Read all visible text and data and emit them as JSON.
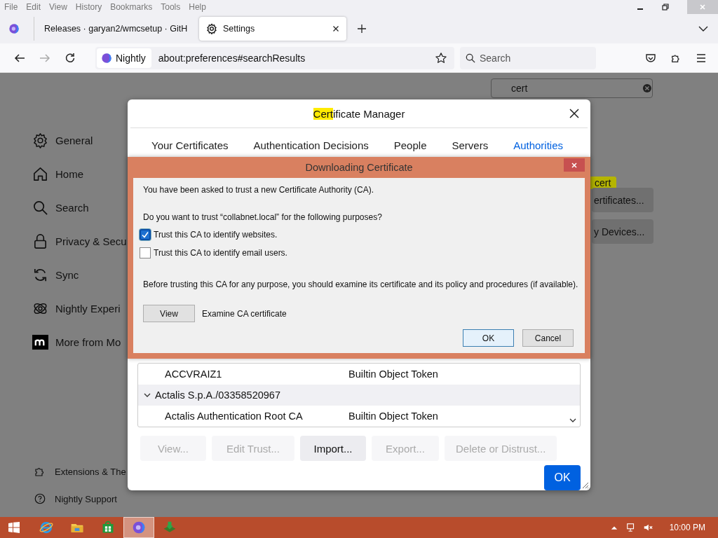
{
  "menu_bar": [
    "File",
    "Edit",
    "View",
    "History",
    "Bookmarks",
    "Tools",
    "Help"
  ],
  "tabs": [
    {
      "kind": "page",
      "title": "Releases · garyan2/wmcsetup · GitH",
      "selected": false
    },
    {
      "kind": "settings",
      "title": "Settings",
      "selected": true
    }
  ],
  "nav": {
    "identity": "Nightly",
    "url": "about:preferences#searchResults",
    "search_placeholder": "Search"
  },
  "preferences": {
    "search": {
      "value": "cert"
    },
    "sidebar": [
      {
        "kind": "gear",
        "label": "General"
      },
      {
        "kind": "home",
        "label": "Home"
      },
      {
        "kind": "search",
        "label": "Search"
      },
      {
        "kind": "lock",
        "label": "Privacy & Secu"
      },
      {
        "kind": "sync",
        "label": "Sync"
      },
      {
        "kind": "atom",
        "label": "Nightly Experi"
      },
      {
        "kind": "mozilla",
        "label": "More from Mo"
      }
    ],
    "footer": [
      {
        "kind": "puzzle",
        "label": "Extensions & The"
      },
      {
        "kind": "help",
        "label": "Nightly Support"
      }
    ],
    "highlight_tag": "cert",
    "buttons": [
      "ertificates...",
      "y Devices..."
    ]
  },
  "certificate_manager": {
    "title_parts": [
      {
        "text": "Cert",
        "highlighted": true
      },
      {
        "text": "ificate Manager",
        "highlighted": false
      }
    ],
    "tabs": [
      {
        "label": "Your Certificates",
        "selected": false
      },
      {
        "label": "Authentication Decisions",
        "selected": false
      },
      {
        "label": "People",
        "selected": false
      },
      {
        "label": "Servers",
        "selected": false
      },
      {
        "label": "Authorities",
        "selected": true
      }
    ],
    "rows": [
      {
        "kind": "cert",
        "name": "ACCVRAIZ1",
        "device": "Builtin Object Token"
      },
      {
        "kind": "group",
        "name": "Actalis S.p.A./03358520967",
        "expanded": true
      },
      {
        "kind": "cert",
        "name": "Actalis Authentication Root CA",
        "device": "Builtin Object Token"
      }
    ],
    "buttons": [
      {
        "label": "View...",
        "disabled": true
      },
      {
        "label": "Edit Trust...",
        "disabled": true
      },
      {
        "label": "Import...",
        "disabled": false
      },
      {
        "label": "Export...",
        "disabled": true
      },
      {
        "label": "Delete or Distrust...",
        "disabled": true
      }
    ],
    "ok": "OK"
  },
  "download_dialog": {
    "title": "Downloading Certificate",
    "intro": "You have been asked to trust a new Certificate Authority (CA).",
    "question": "Do you want to trust “collabnet.local” for the following purposes?",
    "options": [
      {
        "label": "Trust this CA to identify websites.",
        "checked": true
      },
      {
        "label": "Trust this CA to identify email users.",
        "checked": false
      }
    ],
    "advice": "Before trusting this CA for any purpose, you should examine its certificate and its policy and procedures (if available).",
    "view_button": "View",
    "view_label": "Examine CA certificate",
    "buttons": [
      "OK",
      "Cancel"
    ]
  },
  "taskbar": {
    "apps": [
      {
        "kind": "ie",
        "active": false
      },
      {
        "kind": "folder",
        "active": false
      },
      {
        "kind": "store",
        "active": false
      },
      {
        "kind": "firefox",
        "active": true
      },
      {
        "kind": "installer",
        "active": false
      }
    ],
    "clock": "10:00 PM"
  }
}
